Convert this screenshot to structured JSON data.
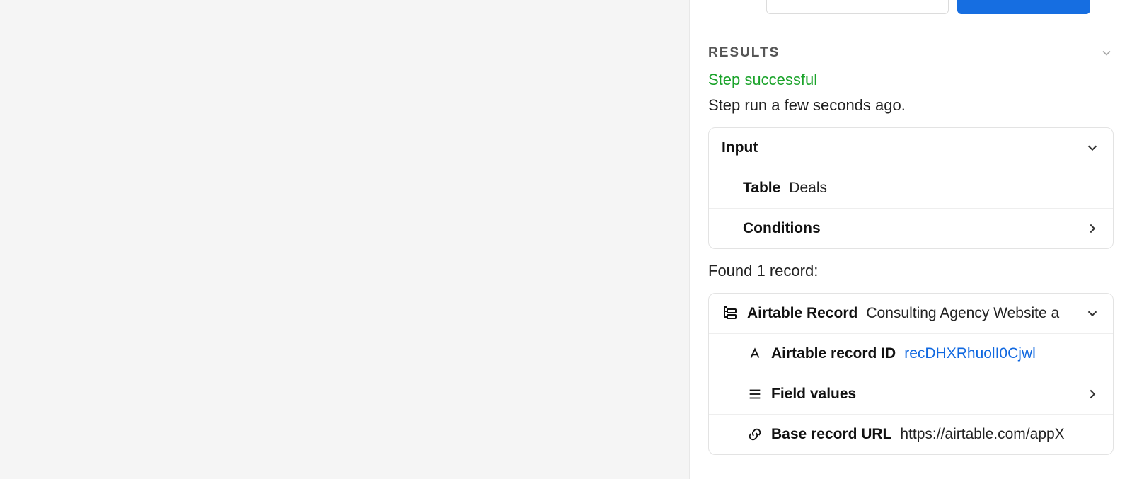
{
  "results": {
    "heading": "RESULTS",
    "status_text": "Step successful",
    "status_time": "Step run a few seconds ago.",
    "input": {
      "label": "Input",
      "table_label": "Table",
      "table_value": "Deals",
      "conditions_label": "Conditions"
    },
    "found_text": "Found 1 record:",
    "record": {
      "title_label": "Airtable Record",
      "title_value": "Consulting Agency Website a",
      "id_label": "Airtable record ID",
      "id_value": "recDHXRhuolI0Cjwl",
      "fields_label": "Field values",
      "url_label": "Base record URL",
      "url_value": "https://airtable.com/appX"
    }
  }
}
